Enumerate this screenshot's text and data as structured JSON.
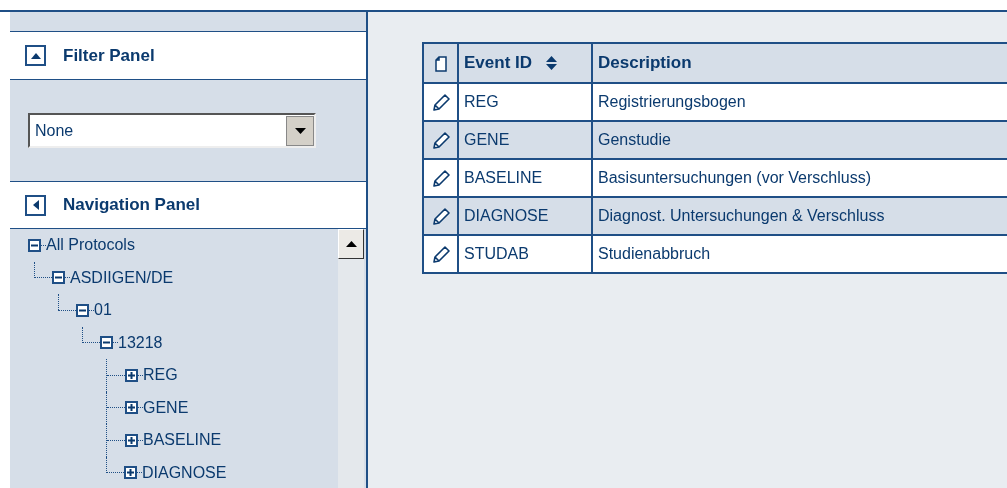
{
  "filter_panel": {
    "title": "Filter Panel",
    "select": {
      "value": "None"
    }
  },
  "navigation_panel": {
    "title": "Navigation Panel"
  },
  "tree": [
    {
      "label": "All Protocols",
      "expanded": true,
      "children": [
        {
          "label": "ASDIIGEN/DE",
          "expanded": true,
          "children": [
            {
              "label": "01",
              "expanded": true,
              "children": [
                {
                  "label": "13218",
                  "expanded": true,
                  "children": [
                    {
                      "label": "REG",
                      "expanded": false
                    },
                    {
                      "label": "GENE",
                      "expanded": false
                    },
                    {
                      "label": "BASELINE",
                      "expanded": false
                    },
                    {
                      "label": "DIAGNOSE",
                      "expanded": false
                    }
                  ]
                }
              ]
            }
          ]
        }
      ]
    }
  ],
  "table": {
    "columns": [
      {
        "label": "Event ID",
        "sortable": true
      },
      {
        "label": "Description",
        "sortable": false
      }
    ],
    "rows": [
      {
        "event_id": "REG",
        "description": "Registrierungsbogen"
      },
      {
        "event_id": "GENE",
        "description": "Genstudie"
      },
      {
        "event_id": "BASELINE",
        "description": "Basisuntersuchungen (vor Verschluss)"
      },
      {
        "event_id": "DIAGNOSE",
        "description": "Diagnost. Untersuchungen & Verschluss"
      },
      {
        "event_id": "STUDAB",
        "description": "Studienabbruch"
      }
    ]
  }
}
